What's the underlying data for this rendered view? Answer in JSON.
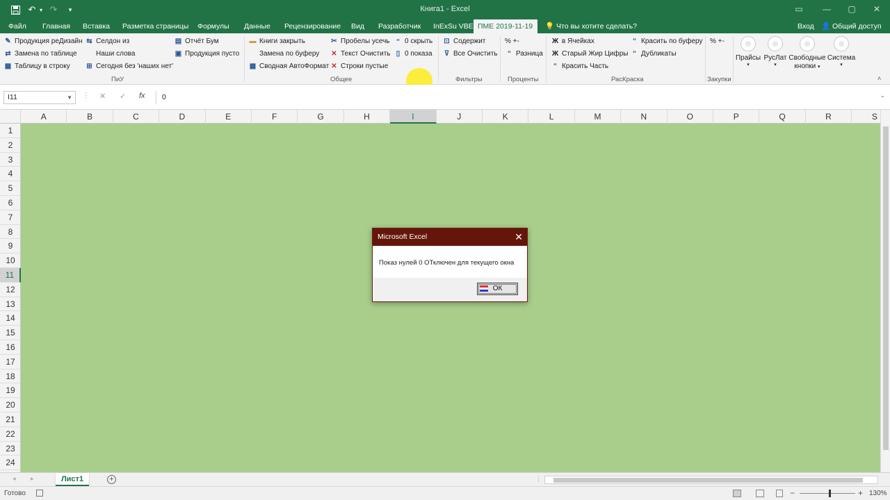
{
  "title_bar": {
    "document_title": "Книга1 - Excel"
  },
  "tabs": [
    {
      "label": "Файл"
    },
    {
      "label": "Главная"
    },
    {
      "label": "Вставка"
    },
    {
      "label": "Разметка страницы"
    },
    {
      "label": "Формулы"
    },
    {
      "label": "Данные"
    },
    {
      "label": "Рецензирование"
    },
    {
      "label": "Вид"
    },
    {
      "label": "Разработчик"
    },
    {
      "label": "InExSu VBE"
    },
    {
      "label": "ПМЕ 2019-11-19",
      "active": true
    }
  ],
  "tell_me": "Что вы хотите сделать?",
  "account": {
    "signin": "Вход",
    "share": "Общий доступ"
  },
  "ribbon": {
    "groups": {
      "piu": "ПиУ",
      "general": "Общее",
      "filters": "Фильтры",
      "percent": "Проценты",
      "coloring": "РасКраска",
      "purchases": "Закупки"
    },
    "buttons": {
      "prod_redesign": "Продукция реДизайн",
      "replace_table": "Замена по таблице",
      "table_to_row": "Таблицу в строку",
      "seldon": "Селдон из",
      "our_words": "Наши слова",
      "today_without": "Сегодня без 'наших нет'",
      "report_boom": "Отчёт Бум",
      "prod_empty": "Продукция пусто",
      "close_books": "Книги закрыть",
      "replace_buffer": "Замена по буферу",
      "pivot_autoformat": "Сводная АвтоФормат",
      "trim_spaces": "Пробелы усечь",
      "text_clear": "Текст Очистить",
      "empty_rows": "Строки пустые",
      "hide_zero": "0 скрыть",
      "show_zero": "0 показа",
      "contains": "Содержит",
      "clear_all": "Все Очистить",
      "pct_pm_1": "% +-",
      "difference": "Разница",
      "in_cells": "в Ячейках",
      "old_bold_digits": "Старый Жир Цифры",
      "color_part": "Красить Часть",
      "color_by_buffer": "Красить по буферу",
      "duplicates": "Дубликаты",
      "pct_pm_2": "% +-",
      "prices": "Прайсы",
      "ruslat": "РусЛат",
      "free_buttons_1": "Свободные",
      "free_buttons_2": "кнопки",
      "system": "Система"
    }
  },
  "formula_bar": {
    "cell_ref": "I11",
    "value": "0",
    "cancel": "✕",
    "enter": "✓",
    "fx": "fx"
  },
  "columns": [
    "A",
    "B",
    "C",
    "D",
    "E",
    "F",
    "G",
    "H",
    "I",
    "J",
    "K",
    "L",
    "M",
    "N",
    "O",
    "P",
    "Q",
    "R",
    "S"
  ],
  "selected_column": "I",
  "rows": [
    "1",
    "2",
    "3",
    "4",
    "5",
    "6",
    "7",
    "8",
    "9",
    "10",
    "11",
    "12",
    "13",
    "14",
    "15",
    "16",
    "17",
    "18",
    "19",
    "20",
    "21",
    "22",
    "23",
    "24"
  ],
  "selected_row": "11",
  "dialog": {
    "title": "Microsoft Excel",
    "message": "Показ нулей 0 ОТключен для текущего окна",
    "ok_label": "ОК"
  },
  "sheet_tabs": [
    {
      "label": "Лист1",
      "active": true
    }
  ],
  "status_bar": {
    "status": "Готово",
    "zoom": "130%"
  },
  "colors": {
    "accent": "#217346",
    "sheet_background": "#a9ce8c",
    "dialog_title": "#64160a"
  }
}
